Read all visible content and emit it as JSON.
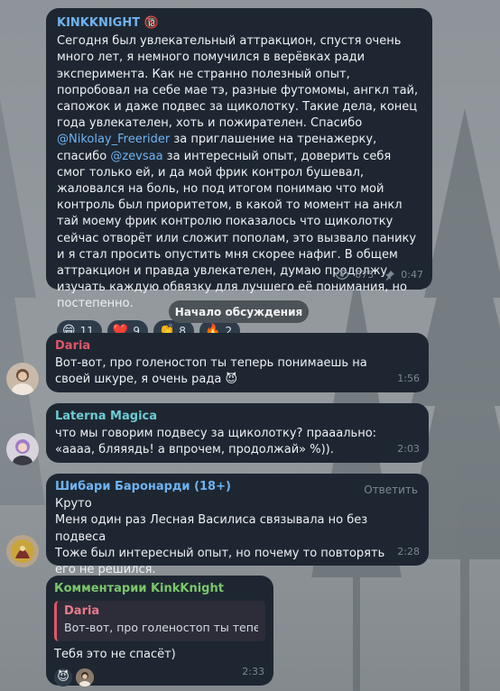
{
  "post": {
    "channel": "KINKKNIGHT",
    "badge": "🔞",
    "p1": "Сегодня был увлекательный аттракцион, спустя очень много лет, я немного помучился в верёвках ради эксперимента.  Как не странно полезный опыт, попробовал на себе мае тэ, разные футомомы, ангкл тай, сапожок и даже подвес за щиколотку. Такие дела, конец года увлекателен, хоть и пожирателен. Спасибо ",
    "mention1": "@Nikolay_Freerider",
    "p2": " за приглашение на тренажерку, спасибо ",
    "mention2": "@zevsaa",
    "p3": " за интересный опыт, доверить себя смог только ей, и да мой фрик контрол бушевал, жаловался на боль, но под итогом понимаю что мой контроль был приоритетом, в какой то момент на анкл тай моему фрик контролю показалось что щиколотку сейчас отворёт или сложит пополам, это вызвало панику и я стал просить опустить мня скорее нафиг.  В общем аттракцион и правда увлекателен, думаю продолжу изучать каждую обвязку для лучшего её понимания, но постепенно.",
    "reactions": [
      {
        "emoji": "😁",
        "count": "11"
      },
      {
        "emoji": "❤️",
        "count": "9"
      },
      {
        "emoji": "👏",
        "count": "8"
      },
      {
        "emoji": "🔥",
        "count": "2"
      }
    ],
    "views": "675",
    "time": "0:47"
  },
  "discussion_label": "Начало обсуждения",
  "messages": [
    {
      "author": "Daria",
      "color": "#e0566a",
      "text": "Вот-вот, про голеностоп ты теперь понимаешь на своей шкуре, я очень рада 😈",
      "time": "1:56"
    },
    {
      "author": "Laterna Magica",
      "color": "#6ecbd6",
      "text": "что мы говорим подвесу за щиколотку? прааально: «аааа, бляяядь! а впрочем, продолжай» %)).",
      "time": "2:03"
    },
    {
      "author": "Шибари Баронарди (18+)",
      "color": "#6fb3f2",
      "reply": "Ответить",
      "text": "Круто\nМеня один раз Лесная Василиса связывала но без подвеса\nТоже был интересный опыт, но почему то повторять его не решился.",
      "time": "2:28"
    },
    {
      "author": "Комментарии KinkKnight",
      "color": "#7cc66c",
      "quote_author": "Daria",
      "quote_text": "Вот-вот, про голеностоп ты тепе...",
      "text": "Тебя это не спасёт)",
      "reaction_emoji": "😈",
      "time": "2:33"
    }
  ],
  "colors": {
    "bubble": "#1e2731",
    "link": "#6fb3f2",
    "background": "#8f969b"
  },
  "icons": [
    "eye-icon",
    "pin-icon"
  ]
}
